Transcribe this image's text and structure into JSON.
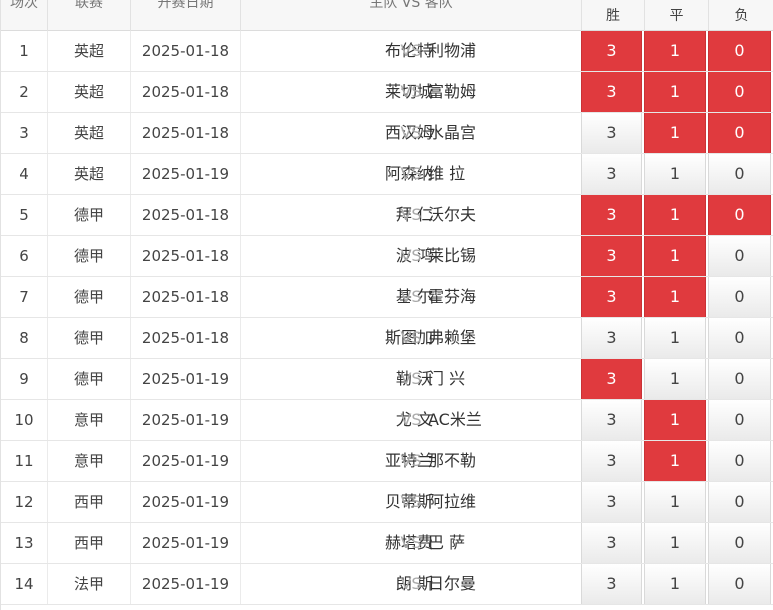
{
  "header": {
    "col_num": "场次",
    "col_league": "联赛",
    "col_date": "开赛日期",
    "col_match": "主队 VS 客队",
    "col_win": "胜",
    "col_draw": "平",
    "col_loss": "负"
  },
  "vs_label": "VS",
  "colors": {
    "selected": "#e03a3e",
    "unselected": "#f2f2f2"
  },
  "rows": [
    {
      "num": "1",
      "league": "英超",
      "date": "2025-01-18",
      "home": "布伦特",
      "away": "利物浦",
      "win": "3",
      "draw": "1",
      "loss": "0",
      "sel": [
        true,
        true,
        true
      ]
    },
    {
      "num": "2",
      "league": "英超",
      "date": "2025-01-18",
      "home": "莱切城",
      "away": "富勒姆",
      "win": "3",
      "draw": "1",
      "loss": "0",
      "sel": [
        true,
        true,
        true
      ]
    },
    {
      "num": "3",
      "league": "英超",
      "date": "2025-01-18",
      "home": "西汉姆",
      "away": "水晶宫",
      "win": "3",
      "draw": "1",
      "loss": "0",
      "sel": [
        false,
        true,
        true
      ]
    },
    {
      "num": "4",
      "league": "英超",
      "date": "2025-01-19",
      "home": "阿森纳",
      "away": "维 拉",
      "win": "3",
      "draw": "1",
      "loss": "0",
      "sel": [
        false,
        false,
        false
      ]
    },
    {
      "num": "5",
      "league": "德甲",
      "date": "2025-01-18",
      "home": "拜 仁",
      "away": "沃尔夫",
      "win": "3",
      "draw": "1",
      "loss": "0",
      "sel": [
        true,
        true,
        true
      ]
    },
    {
      "num": "6",
      "league": "德甲",
      "date": "2025-01-18",
      "home": "波 鸿",
      "away": "莱比锡",
      "win": "3",
      "draw": "1",
      "loss": "0",
      "sel": [
        true,
        true,
        false
      ]
    },
    {
      "num": "7",
      "league": "德甲",
      "date": "2025-01-18",
      "home": "基 尔",
      "away": "霍芬海",
      "win": "3",
      "draw": "1",
      "loss": "0",
      "sel": [
        true,
        true,
        false
      ]
    },
    {
      "num": "8",
      "league": "德甲",
      "date": "2025-01-18",
      "home": "斯图加",
      "away": "弗赖堡",
      "win": "3",
      "draw": "1",
      "loss": "0",
      "sel": [
        false,
        false,
        false
      ]
    },
    {
      "num": "9",
      "league": "德甲",
      "date": "2025-01-19",
      "home": "勒 沃",
      "away": "门 兴",
      "win": "3",
      "draw": "1",
      "loss": "0",
      "sel": [
        true,
        false,
        false
      ]
    },
    {
      "num": "10",
      "league": "意甲",
      "date": "2025-01-19",
      "home": "尤 文",
      "away": "AC米兰",
      "win": "3",
      "draw": "1",
      "loss": "0",
      "sel": [
        false,
        true,
        false
      ]
    },
    {
      "num": "11",
      "league": "意甲",
      "date": "2025-01-19",
      "home": "亚特兰",
      "away": "那不勒",
      "win": "3",
      "draw": "1",
      "loss": "0",
      "sel": [
        false,
        true,
        false
      ]
    },
    {
      "num": "12",
      "league": "西甲",
      "date": "2025-01-19",
      "home": "贝蒂斯",
      "away": "阿拉维",
      "win": "3",
      "draw": "1",
      "loss": "0",
      "sel": [
        false,
        false,
        false
      ]
    },
    {
      "num": "13",
      "league": "西甲",
      "date": "2025-01-19",
      "home": "赫塔费",
      "away": "巴 萨",
      "win": "3",
      "draw": "1",
      "loss": "0",
      "sel": [
        false,
        false,
        false
      ]
    },
    {
      "num": "14",
      "league": "法甲",
      "date": "2025-01-19",
      "home": "朗 斯",
      "away": "日尔曼",
      "win": "3",
      "draw": "1",
      "loss": "0",
      "sel": [
        false,
        false,
        false
      ]
    }
  ]
}
